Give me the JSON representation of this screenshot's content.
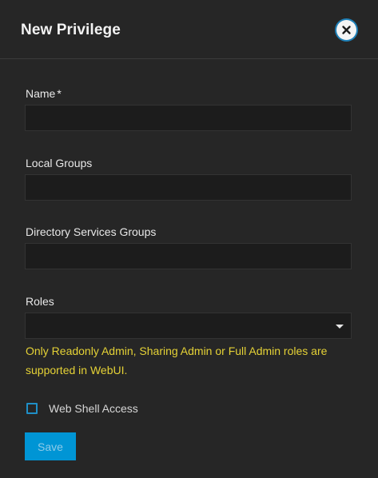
{
  "dialog": {
    "title": "New Privilege",
    "close_icon": "close-circle-icon"
  },
  "form": {
    "name": {
      "label": "Name",
      "required_mark": "*",
      "value": ""
    },
    "local_groups": {
      "label": "Local Groups",
      "value": ""
    },
    "directory_services_groups": {
      "label": "Directory Services Groups",
      "value": ""
    },
    "roles": {
      "label": "Roles",
      "value": "",
      "hint": "Only Readonly Admin, Sharing Admin or Full Admin roles are supported in WebUI."
    },
    "web_shell_access": {
      "label": "Web Shell Access",
      "checked": false
    },
    "save_label": "Save"
  },
  "colors": {
    "background": "#262626",
    "input_background": "#1c1c1c",
    "accent": "#0095d5",
    "warning_text": "#e5d236"
  }
}
